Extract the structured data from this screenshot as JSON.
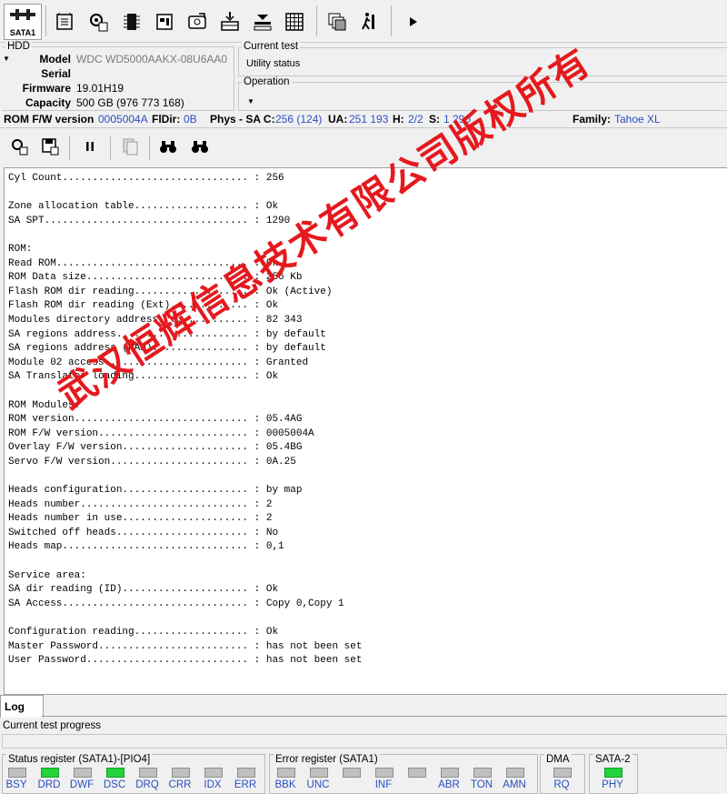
{
  "toolbar": {
    "interface_label": "SATA1",
    "icons": [
      "sata-port-icon",
      "chip-read-icon",
      "gear-chip-icon",
      "chip-icon",
      "ssd-icon",
      "disk-tools-icon",
      "flash-write-icon",
      "drive-level-icon",
      "grid-table-icon",
      "copy-windows-icon",
      "run-person-icon",
      "play-icon"
    ]
  },
  "hdd": {
    "group_label": "HDD",
    "model_label": "Model",
    "model": "WDC WD5000AAKX-08U6AA0",
    "serial_label": "Serial",
    "serial": "",
    "firmware_label": "Firmware",
    "firmware": "19.01H19",
    "capacity_label": "Capacity",
    "capacity": "500 GB (976 773 168)"
  },
  "current_test": {
    "label": "Current test",
    "value": "Utility status"
  },
  "operation": {
    "label": "Operation",
    "value": ""
  },
  "fw_status": {
    "rom_fw_label": "ROM F/W version",
    "rom_fw": "0005004A",
    "fldir_label": "FlDir:",
    "fldir": "0B",
    "phys_label": "Phys - SA C:",
    "phys_sac": "256 (124)",
    "ua_label": "UA:",
    "ua": "251 193",
    "h_label": "H:",
    "h": "2/2",
    "s_label": "S:",
    "s": "1 290",
    "family_label": "Family:",
    "family": "Tahoe XL"
  },
  "log_text": "Cyl Count............................... : 256\n\nZone allocation table................... : Ok\nSA SPT.................................. : 1290\n\nROM:\nRead ROM................................ : Ok\nROM Data size........................... : 256 Kb\nFlash ROM dir reading................... : Ok (Active)\nFlash ROM dir reading (Ext)............. : Ok\nModules directory address............... : 82 343\nSA regions address...................... : by default\nSA regions address (RAM)................ : by default\nModule 02 access........................ : Granted\nSA Translator loading................... : Ok\n\nROM Modules:\nROM version............................. : 05.4AG\nROM F/W version......................... : 0005004A\nOverlay F/W version..................... : 05.4BG\nServo F/W version....................... : 0A.25\n\nHeads configuration..................... : by map\nHeads number............................ : 2\nHeads number in use..................... : 2\nSwitched off heads...................... : No\nHeads map............................... : 0,1\n\nService area:\nSA dir reading (ID)..................... : Ok\nSA Access............................... : Copy 0,Copy 1\n\nConfiguration reading................... : Ok\nMaster Password......................... : has not been set\nUser Password........................... : has not been set",
  "watermark": "武汉恒辉信息技术有限公司版权所有",
  "tabs": {
    "log": "Log"
  },
  "progress": {
    "label": "Current test progress"
  },
  "registers": {
    "status": {
      "title": "Status register (SATA1)-[PIO4]",
      "bits": [
        {
          "name": "BSY",
          "on": false
        },
        {
          "name": "DRD",
          "on": true
        },
        {
          "name": "DWF",
          "on": false
        },
        {
          "name": "DSC",
          "on": true
        },
        {
          "name": "DRQ",
          "on": false
        },
        {
          "name": "CRR",
          "on": false
        },
        {
          "name": "IDX",
          "on": false
        },
        {
          "name": "ERR",
          "on": false
        }
      ]
    },
    "error": {
      "title": "Error register (SATA1)",
      "bits": [
        {
          "name": "BBK",
          "on": false
        },
        {
          "name": "UNC",
          "on": false
        },
        {
          "name": "",
          "on": false
        },
        {
          "name": "INF",
          "on": false
        },
        {
          "name": "",
          "on": false
        },
        {
          "name": "ABR",
          "on": false
        },
        {
          "name": "TON",
          "on": false
        },
        {
          "name": "AMN",
          "on": false
        }
      ]
    },
    "dma": {
      "title": "DMA",
      "bits": [
        {
          "name": "RQ",
          "on": false
        }
      ]
    },
    "sata2": {
      "title": "SATA-2",
      "bits": [
        {
          "name": "PHY",
          "on": true
        }
      ]
    }
  },
  "colors": {
    "led_on": "#22d43a",
    "led_off": "#c0c0c0",
    "value_blue": "#2a4fc0",
    "watermark": "#e5191e"
  }
}
